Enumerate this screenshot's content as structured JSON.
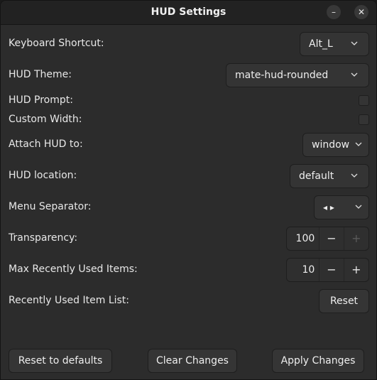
{
  "window": {
    "title": "HUD Settings",
    "minimize_glyph": "–",
    "close_glyph": "✕"
  },
  "settings": {
    "keyboard_shortcut": {
      "label": "Keyboard Shortcut:",
      "value": "Alt_L"
    },
    "hud_theme": {
      "label": "HUD Theme:",
      "value": "mate-hud-rounded"
    },
    "hud_prompt": {
      "label": "HUD Prompt:",
      "checked": false
    },
    "custom_width": {
      "label": "Custom Width:",
      "checked": false
    },
    "attach_hud_to": {
      "label": "Attach HUD to:",
      "value": "window"
    },
    "hud_location": {
      "label": "HUD location:",
      "value": "default"
    },
    "menu_separator": {
      "label": "Menu Separator:",
      "value": "◂ ▸"
    },
    "transparency": {
      "label": "Transparency:",
      "value": "100",
      "minus": "−",
      "plus": "+",
      "plus_disabled": true
    },
    "max_recent_items": {
      "label": "Max Recently Used Items:",
      "value": "10",
      "minus": "−",
      "plus": "+"
    },
    "recent_item_list": {
      "label": "Recently Used Item List:",
      "button": "Reset"
    }
  },
  "footer": {
    "reset_defaults": "Reset to defaults",
    "clear_changes": "Clear Changes",
    "apply_changes": "Apply Changes"
  }
}
